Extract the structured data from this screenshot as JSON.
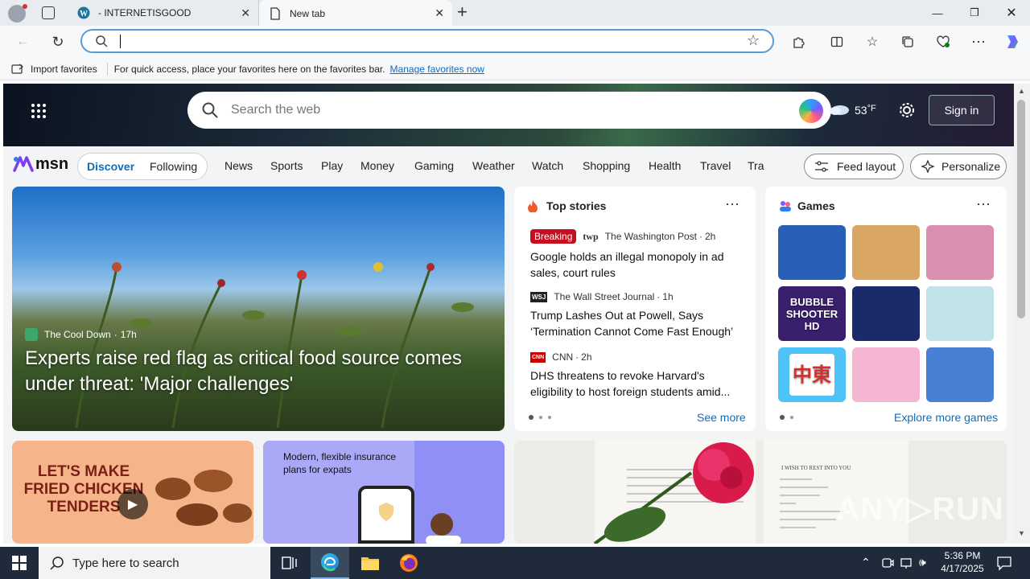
{
  "tabs": [
    {
      "title": "- INTERNETISGOOD",
      "icon": "wordpress-icon"
    },
    {
      "title": "New tab",
      "icon": "page-icon"
    }
  ],
  "addressbar": {
    "value": "",
    "placeholder": ""
  },
  "favorites": {
    "import_label": "Import favorites",
    "hint": "For quick access, place your favorites here on the favorites bar.",
    "manage_link": "Manage favorites now"
  },
  "msn": {
    "search_placeholder": "Search the web",
    "weather_temp": "53",
    "weather_unit": "°F",
    "signin": "Sign in",
    "logo_text": "msn",
    "toggle": [
      "Discover",
      "Following"
    ],
    "nav": [
      "News",
      "Sports",
      "Play",
      "Money",
      "Gaming",
      "Weather",
      "Watch",
      "Shopping",
      "Health",
      "Travel",
      "Tra"
    ],
    "feed_layout": "Feed layout",
    "personalize": "Personalize"
  },
  "hero": {
    "source": "The Cool Down",
    "age": "17h",
    "title": "Experts raise red flag as critical food source comes under threat: 'Major challenges'"
  },
  "top_stories": {
    "heading": "Top stories",
    "items": [
      {
        "badge": "Breaking",
        "logo": "twp",
        "source": "The Washington Post",
        "age": "2h",
        "title": "Google holds an illegal monopoly in ad sales, court rules"
      },
      {
        "logo": "WSJ",
        "source": "The Wall Street Journal",
        "age": "1h",
        "title": "Trump Lashes Out at Powell, Says ‘Termination Cannot Come Fast Enough’"
      },
      {
        "logo": "CNN",
        "source": "CNN",
        "age": "2h",
        "title": "DHS threatens to revoke Harvard's eligibility to host foreign students amid..."
      }
    ],
    "see_more": "See more"
  },
  "games": {
    "heading": "Games",
    "explore": "Explore more games",
    "tiles": [
      {
        "name": "jewel-game",
        "bg": "#2a5fb8",
        "text": ""
      },
      {
        "name": "wood-screw-game",
        "bg": "#d9a664",
        "text": ""
      },
      {
        "name": "makeup-game",
        "bg": "#d88fb0",
        "text": ""
      },
      {
        "name": "bubble-shooter-game",
        "bg": "#3a1f6e",
        "text": "BUBBLE SHOOTER HD"
      },
      {
        "name": "block-puzzle-game",
        "bg": "#1b2a68",
        "text": ""
      },
      {
        "name": "hospital-game",
        "bg": "#bfe3e8",
        "text": ""
      },
      {
        "name": "mahjong-game",
        "bg": "#4fc3f7",
        "text": "中東"
      },
      {
        "name": "dressup-game",
        "bg": "#f4b6d2",
        "text": ""
      },
      {
        "name": "hotel-game",
        "bg": "#4a7fd6",
        "text": ""
      }
    ]
  },
  "bottom": {
    "ad1": "LET'S MAKE FRIED CHICKEN TENDERS",
    "ad2_text": "Modern, flexible insurance plans for expats",
    "book_line1": "I WISH TO REST INTO YOU"
  },
  "taskbar": {
    "search_placeholder": "Type here to search",
    "time": "5:36 PM",
    "date": "4/17/2025"
  },
  "colors": {
    "accent": "#0f6cbd",
    "breaking": "#c50f1f",
    "taskbar": "#1f2b3a"
  }
}
